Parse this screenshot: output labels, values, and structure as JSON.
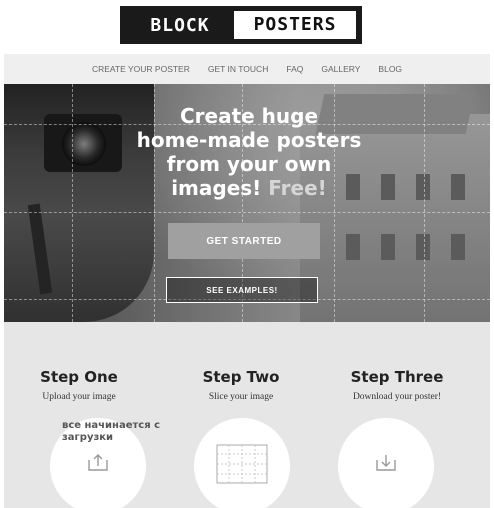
{
  "logo": {
    "part1": "BLOCK",
    "part2": "POSTERS"
  },
  "nav": {
    "items": [
      {
        "label": "CREATE YOUR POSTER"
      },
      {
        "label": "GET IN TOUCH"
      },
      {
        "label": "FAQ"
      },
      {
        "label": "GALLERY"
      },
      {
        "label": "BLOG"
      }
    ]
  },
  "hero": {
    "title_line1": "Create huge",
    "title_line2": "home-made posters",
    "title_line3": "from your own",
    "title_line4_main": "images!",
    "title_line4_accent": "Free!",
    "cta_primary": "GET STARTED",
    "cta_secondary": "SEE EXAMPLES!"
  },
  "steps": [
    {
      "title": "Step One",
      "desc": "Upload your image",
      "icon": "upload-icon"
    },
    {
      "title": "Step Two",
      "desc": "Slice your image",
      "icon": "slice-grid-icon"
    },
    {
      "title": "Step Three",
      "desc": "Download your poster!",
      "icon": "download-icon"
    }
  ],
  "overlay_note": "все начинается с загрузки",
  "colors": {
    "logo_bg": "#1a1a1a",
    "nav_bg": "#efefef",
    "steps_bg": "#e6e6e6",
    "button_primary": "#a0a0a0"
  }
}
